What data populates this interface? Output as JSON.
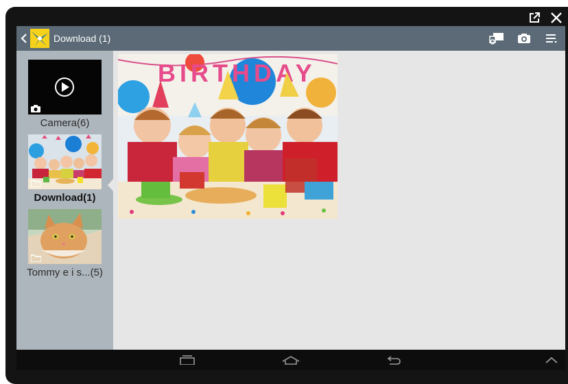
{
  "window": {
    "popout_icon": "popout-icon",
    "close_icon": "close-icon"
  },
  "action_bar": {
    "title": "Download (1)",
    "back_icon": "chevron-left-icon",
    "app_icon": "gallery-app-icon",
    "actions": [
      "share-to-device-icon",
      "camera-icon",
      "menu-icon"
    ]
  },
  "albums": [
    {
      "label": "Camera(6)",
      "type_icon": "camera-icon",
      "has_play_overlay": true
    },
    {
      "label": "Download(1)",
      "type_icon": "folder-icon",
      "selected": true
    },
    {
      "label": "Tommy e i s...(5)",
      "type_icon": "folder-icon"
    }
  ],
  "content": {
    "photos": [
      {
        "subject": "birthday-party-photo",
        "banner_text": "BIRTHDAY"
      }
    ]
  },
  "navbar": {
    "buttons": [
      "recent-apps-icon",
      "home-icon",
      "back-icon",
      "chevron-up-icon"
    ]
  },
  "colors": {
    "action_bar": "#5b6a76",
    "sidebar": "#aeb6bd",
    "content_bg": "#e6e6e6",
    "navbar": "#0d0d0d"
  }
}
